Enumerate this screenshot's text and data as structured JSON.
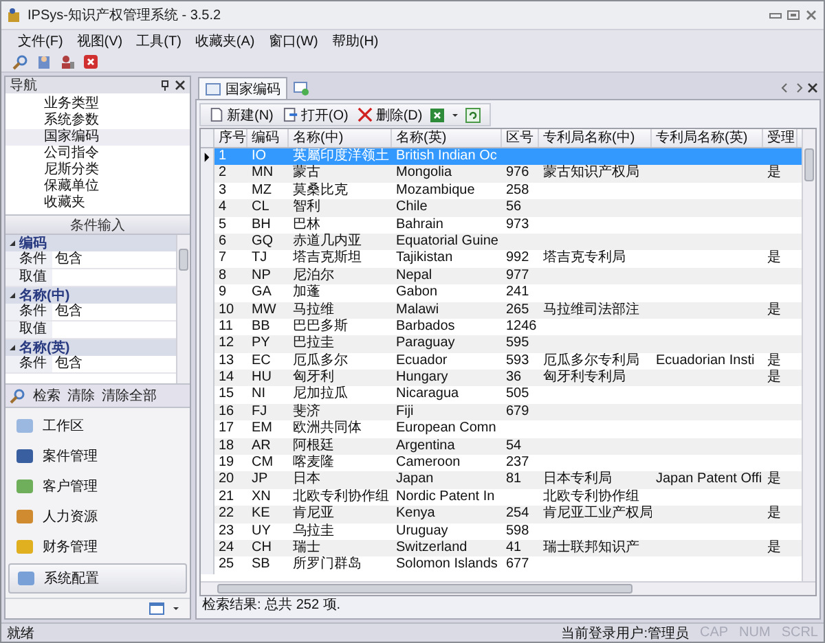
{
  "window": {
    "title": "IPSys-知识产权管理系统 - 3.5.2"
  },
  "menu": [
    "文件(F)",
    "视图(V)",
    "工具(T)",
    "收藏夹(A)",
    "窗口(W)",
    "帮助(H)"
  ],
  "nav": {
    "title": "导航",
    "items": [
      {
        "label": "业务类型",
        "selected": false
      },
      {
        "label": "系统参数",
        "selected": false
      },
      {
        "label": "国家编码",
        "selected": true
      },
      {
        "label": "公司指令",
        "selected": false
      },
      {
        "label": "尼斯分类",
        "selected": false
      },
      {
        "label": "保藏单位",
        "selected": false
      },
      {
        "label": "收藏夹",
        "selected": false
      }
    ]
  },
  "conditions": {
    "title": "条件输入",
    "groups": [
      {
        "name": "编码",
        "expanded": true,
        "rows": [
          {
            "label": "条件",
            "value": "包含"
          },
          {
            "label": "取值"
          }
        ]
      },
      {
        "name": "名称(中)",
        "expanded": true,
        "rows": [
          {
            "label": "条件",
            "value": "包含"
          },
          {
            "label": "取值"
          }
        ]
      },
      {
        "name": "名称(英)",
        "expanded": true,
        "rows": [
          {
            "label": "条件",
            "value": "包含"
          }
        ]
      }
    ],
    "actions": [
      "检索",
      "清除",
      "清除全部"
    ]
  },
  "modules": [
    {
      "label": "工作区",
      "selected": false
    },
    {
      "label": "案件管理",
      "selected": false
    },
    {
      "label": "客户管理",
      "selected": false
    },
    {
      "label": "人力资源",
      "selected": false
    },
    {
      "label": "财务管理",
      "selected": false
    },
    {
      "label": "系统配置",
      "selected": true
    }
  ],
  "tabs": [
    {
      "label": "国家编码",
      "selected": true
    }
  ],
  "toolbar": [
    "新建(N)",
    "打开(O)",
    "删除(D)"
  ],
  "table": {
    "columns": [
      "序号",
      "编码",
      "名称(中)",
      "名称(英)",
      "区号",
      "专利局名称(中)",
      "专利局名称(英)",
      "受理"
    ],
    "rows": [
      {
        "selected": true,
        "no": "1",
        "code": "IO",
        "name_cn": "英屬印度洋领土",
        "name_en": "British Indian Oc"
      },
      {
        "selected": false,
        "no": "2",
        "code": "MN",
        "name_cn": "蒙古",
        "name_en": "Mongolia",
        "area": "976",
        "office_cn": "蒙古知识产权局",
        "accept": "是"
      },
      {
        "selected": false,
        "no": "3",
        "code": "MZ",
        "name_cn": "莫桑比克",
        "name_en": "Mozambique",
        "area": "258"
      },
      {
        "selected": false,
        "no": "4",
        "code": "CL",
        "name_cn": "智利",
        "name_en": "Chile",
        "area": "56"
      },
      {
        "selected": false,
        "no": "5",
        "code": "BH",
        "name_cn": "巴林",
        "name_en": "Bahrain",
        "area": "973"
      },
      {
        "selected": false,
        "no": "6",
        "code": "GQ",
        "name_cn": "赤道几内亚",
        "name_en": "Equatorial Guine"
      },
      {
        "selected": false,
        "no": "7",
        "code": "TJ",
        "name_cn": "塔吉克斯坦",
        "name_en": "Tajikistan",
        "area": "992",
        "office_cn": "塔吉克专利局",
        "accept": "是"
      },
      {
        "selected": false,
        "no": "8",
        "code": "NP",
        "name_cn": "尼泊尔",
        "name_en": "Nepal",
        "area": "977"
      },
      {
        "selected": false,
        "no": "9",
        "code": "GA",
        "name_cn": "加蓬",
        "name_en": "Gabon",
        "area": "241"
      },
      {
        "selected": false,
        "no": "10",
        "code": "MW",
        "name_cn": "马拉维",
        "name_en": "Malawi",
        "area": "265",
        "office_cn": "马拉维司法部注",
        "accept": "是"
      },
      {
        "selected": false,
        "no": "11",
        "code": "BB",
        "name_cn": "巴巴多斯",
        "name_en": "Barbados",
        "area": "1246"
      },
      {
        "selected": false,
        "no": "12",
        "code": "PY",
        "name_cn": "巴拉圭",
        "name_en": "Paraguay",
        "area": "595"
      },
      {
        "selected": false,
        "no": "13",
        "code": "EC",
        "name_cn": "厄瓜多尔",
        "name_en": "Ecuador",
        "area": "593",
        "office_cn": "厄瓜多尔专利局",
        "office_en": "Ecuadorian Insti",
        "accept": "是"
      },
      {
        "selected": false,
        "no": "14",
        "code": "HU",
        "name_cn": "匈牙利",
        "name_en": "Hungary",
        "area": "36",
        "office_cn": "匈牙利专利局",
        "accept": "是"
      },
      {
        "selected": false,
        "no": "15",
        "code": "NI",
        "name_cn": "尼加拉瓜",
        "name_en": "Nicaragua",
        "area": "505"
      },
      {
        "selected": false,
        "no": "16",
        "code": "FJ",
        "name_cn": "斐济",
        "name_en": "Fiji",
        "area": "679"
      },
      {
        "selected": false,
        "no": "17",
        "code": "EM",
        "name_cn": "欧洲共同体",
        "name_en": "European Comn"
      },
      {
        "selected": false,
        "no": "18",
        "code": "AR",
        "name_cn": "阿根廷",
        "name_en": "Argentina",
        "area": "54"
      },
      {
        "selected": false,
        "no": "19",
        "code": "CM",
        "name_cn": "喀麦隆",
        "name_en": "Cameroon",
        "area": "237"
      },
      {
        "selected": false,
        "no": "20",
        "code": "JP",
        "name_cn": "日本",
        "name_en": "Japan",
        "area": "81",
        "office_cn": "日本专利局",
        "office_en": "Japan Patent Offi",
        "accept": "是"
      },
      {
        "selected": false,
        "no": "21",
        "code": "XN",
        "name_cn": "北欧专利协作组",
        "name_en": "Nordic Patent In",
        "office_cn": "北欧专利协作组"
      },
      {
        "selected": false,
        "no": "22",
        "code": "KE",
        "name_cn": "肯尼亚",
        "name_en": "Kenya",
        "area": "254",
        "office_cn": "肯尼亚工业产权局",
        "accept": "是"
      },
      {
        "selected": false,
        "no": "23",
        "code": "UY",
        "name_cn": "乌拉圭",
        "name_en": "Uruguay",
        "area": "598"
      },
      {
        "selected": false,
        "no": "24",
        "code": "CH",
        "name_cn": "瑞士",
        "name_en": "Switzerland",
        "area": "41",
        "office_cn": "瑞士联邦知识产",
        "accept": "是"
      },
      {
        "selected": false,
        "no": "25",
        "code": "SB",
        "name_cn": "所罗门群岛",
        "name_en": "Solomon Islands",
        "area": "677"
      }
    ]
  },
  "result": "检索结果: 总共 252 项.",
  "status_bar": {
    "text": "就绪",
    "user": "当前登录用户:管理员",
    "indicators": [
      {
        "label": "CAP",
        "disabled": true
      },
      {
        "label": "NUM",
        "disabled": true
      },
      {
        "label": "SCRL",
        "disabled": true
      }
    ]
  }
}
